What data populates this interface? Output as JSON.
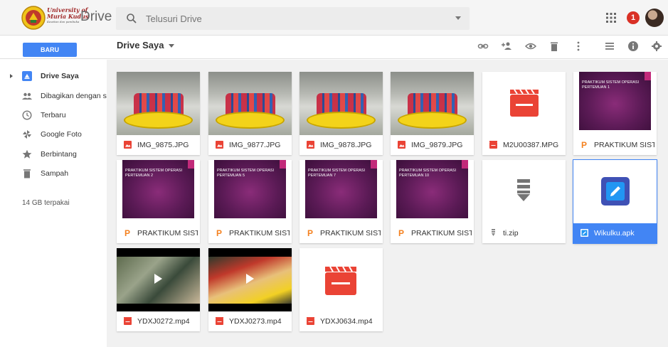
{
  "app": {
    "university_line1": "University of",
    "university_line2": "Muria Kudus",
    "university_tagline": "Kawitan dan pambuka",
    "product_name": "Drive"
  },
  "search": {
    "placeholder": "Telusuri Drive"
  },
  "header": {
    "notification_count": "1"
  },
  "toolbar": {
    "new_label": "BARU",
    "breadcrumb": "Drive Saya"
  },
  "sidebar": {
    "items": [
      {
        "label": "Drive Saya",
        "icon": "drive-icon",
        "active": true
      },
      {
        "label": "Dibagikan dengan saya",
        "icon": "shared-people-icon"
      },
      {
        "label": "Terbaru",
        "icon": "clock-icon"
      },
      {
        "label": "Google Foto",
        "icon": "pinwheel-icon"
      },
      {
        "label": "Berbintang",
        "icon": "star-icon"
      },
      {
        "label": "Sampah",
        "icon": "trash-icon"
      }
    ],
    "storage": "14 GB terpakai"
  },
  "files": [
    {
      "name": "IMG_9875.JPG",
      "type": "image"
    },
    {
      "name": "IMG_9877.JPG",
      "type": "image"
    },
    {
      "name": "IMG_9878.JPG",
      "type": "image"
    },
    {
      "name": "IMG_9879.JPG",
      "type": "image"
    },
    {
      "name": "M2U00387.MPG",
      "type": "video"
    },
    {
      "name": "PRAKTIKUM SISTE...",
      "type": "presentation",
      "slide_title": "PRAKTIKUM SISTEM OPERASI PERTEMUAN 1"
    },
    {
      "name": "PRAKTIKUM SISTE...",
      "type": "presentation",
      "slide_title": "PRAKTIKUM SISTEM OPERASI PERTEMUAN 2"
    },
    {
      "name": "PRAKTIKUM SISTE...",
      "type": "presentation",
      "slide_title": "PRAKTIKUM SISTEM OPERASI PERTEMUAN 5"
    },
    {
      "name": "PRAKTIKUM SISTE...",
      "type": "presentation",
      "slide_title": "PRAKTIKUM SISTEM OPERASI PERTEMUAN 7"
    },
    {
      "name": "PRAKTIKUM SISTE...",
      "type": "presentation",
      "slide_title": "PRAKTIKUM SISTEM OPERASI PERTEMUAN 10"
    },
    {
      "name": "ti.zip",
      "type": "zip"
    },
    {
      "name": "Wikulku.apk",
      "type": "apk",
      "selected": true
    },
    {
      "name": "YDXJ0272.mp4",
      "type": "video"
    },
    {
      "name": "YDXJ0273.mp4",
      "type": "video"
    },
    {
      "name": "YDXJ0634.mp4",
      "type": "video"
    }
  ],
  "colors": {
    "accent": "#4285f4",
    "image_icon": "#ea4335",
    "video_icon": "#ea4335",
    "slides_icon": "#f4811f",
    "notification": "#d93025"
  }
}
